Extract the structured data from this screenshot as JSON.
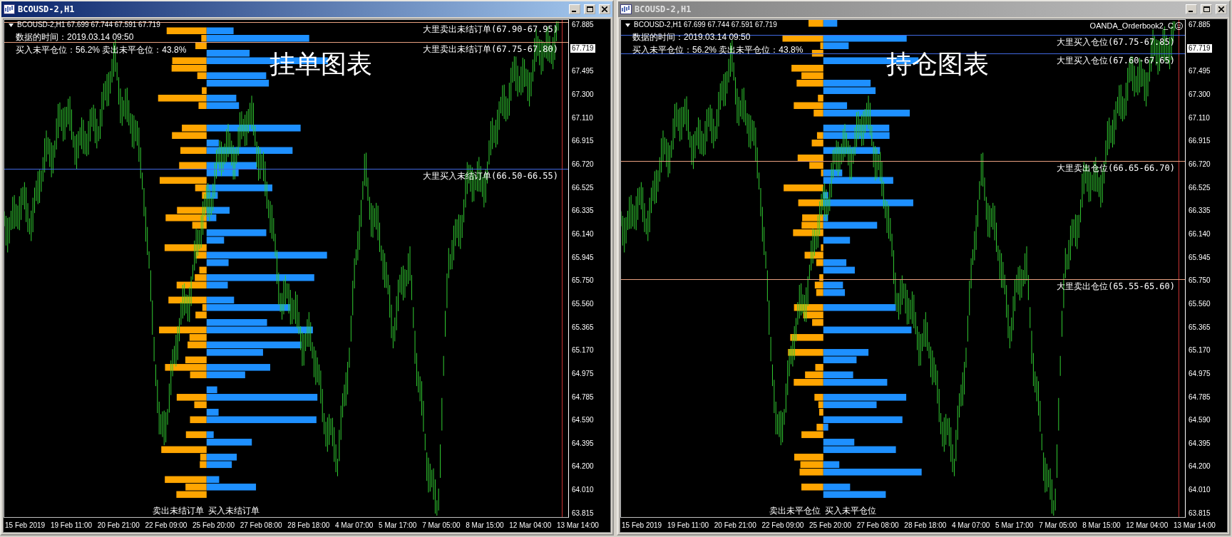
{
  "windows": [
    {
      "title": "BCOUSD-2,H1",
      "active": true,
      "chart": {
        "symbol_line": "BCOUSD-2,H1  67.699 67.744 67.591 67.719",
        "data_time": "数据的时间：2019.03.14 09:50",
        "positions": "买入未平仓位：56.2% 卖出未平仓位：43.8%",
        "big_label": "挂单图表",
        "levels": [
          {
            "label": "大里卖出未结订单(67.90-67.95)",
            "kind": "sell"
          },
          {
            "label": "大里卖出未结订单(67.75-67.80)",
            "kind": "sell"
          },
          {
            "label": "大里买入未结订单(66.50-66.55)",
            "kind": "buy"
          }
        ],
        "sell_label": "卖出未结订单",
        "buy_label": "买入未结订单",
        "current_price": "67.719",
        "price_axis": [
          "67.885",
          "67.495",
          "67.300",
          "67.110",
          "66.915",
          "66.720",
          "66.525",
          "66.335",
          "66.140",
          "65.945",
          "65.750",
          "65.560",
          "65.365",
          "65.170",
          "64.975",
          "64.785",
          "64.590",
          "64.395",
          "64.200",
          "64.010",
          "63.815"
        ],
        "time_axis": [
          "15 Feb 2019",
          "19 Feb 11:00",
          "20 Feb 21:00",
          "22 Feb 09:00",
          "25 Feb 20:00",
          "27 Feb 08:00",
          "28 Feb 18:00",
          "4 Mar 07:00",
          "5 Mar 17:00",
          "7 Mar 05:00",
          "8 Mar 15:00",
          "12 Mar 04:00",
          "13 Mar 14:00"
        ]
      }
    },
    {
      "title": "BCOUSD-2,H1",
      "active": false,
      "chart": {
        "symbol_line": "BCOUSD-2,H1  67.699 67.744 67.591 67.719",
        "data_time": "数据的时间：2019.03.14 09:50",
        "positions": "买入未平仓位：56.2% 卖出未平仓位：43.8%",
        "big_label": "持仓图表",
        "indicator_name": "OANDA_Orderbook2_C",
        "levels": [
          {
            "label": "大里买入仓位(67.75-67.85)",
            "kind": "buy"
          },
          {
            "label": "大里买入仓位(67.60-67.65)",
            "kind": "buy"
          },
          {
            "label": "大里卖出仓位(66.65-66.70)",
            "kind": "sell"
          },
          {
            "label": "大里卖出仓位(65.55-65.60)",
            "kind": "sell"
          }
        ],
        "sell_label": "卖出未平仓位",
        "buy_label": "买入未平仓位",
        "current_price": "67.719",
        "price_axis": [
          "67.885",
          "67.495",
          "67.300",
          "67.110",
          "66.915",
          "66.720",
          "66.525",
          "66.335",
          "66.140",
          "65.945",
          "65.750",
          "65.560",
          "65.365",
          "65.170",
          "64.975",
          "64.785",
          "64.590",
          "64.395",
          "64.200",
          "64.010",
          "63.815"
        ],
        "time_axis": [
          "15 Feb 2019",
          "19 Feb 11:00",
          "20 Feb 21:00",
          "22 Feb 09:00",
          "25 Feb 20:00",
          "27 Feb 08:00",
          "28 Feb 18:00",
          "4 Mar 07:00",
          "5 Mar 17:00",
          "7 Mar 05:00",
          "8 Mar 15:00",
          "12 Mar 04:00",
          "13 Mar 14:00"
        ]
      }
    }
  ]
}
